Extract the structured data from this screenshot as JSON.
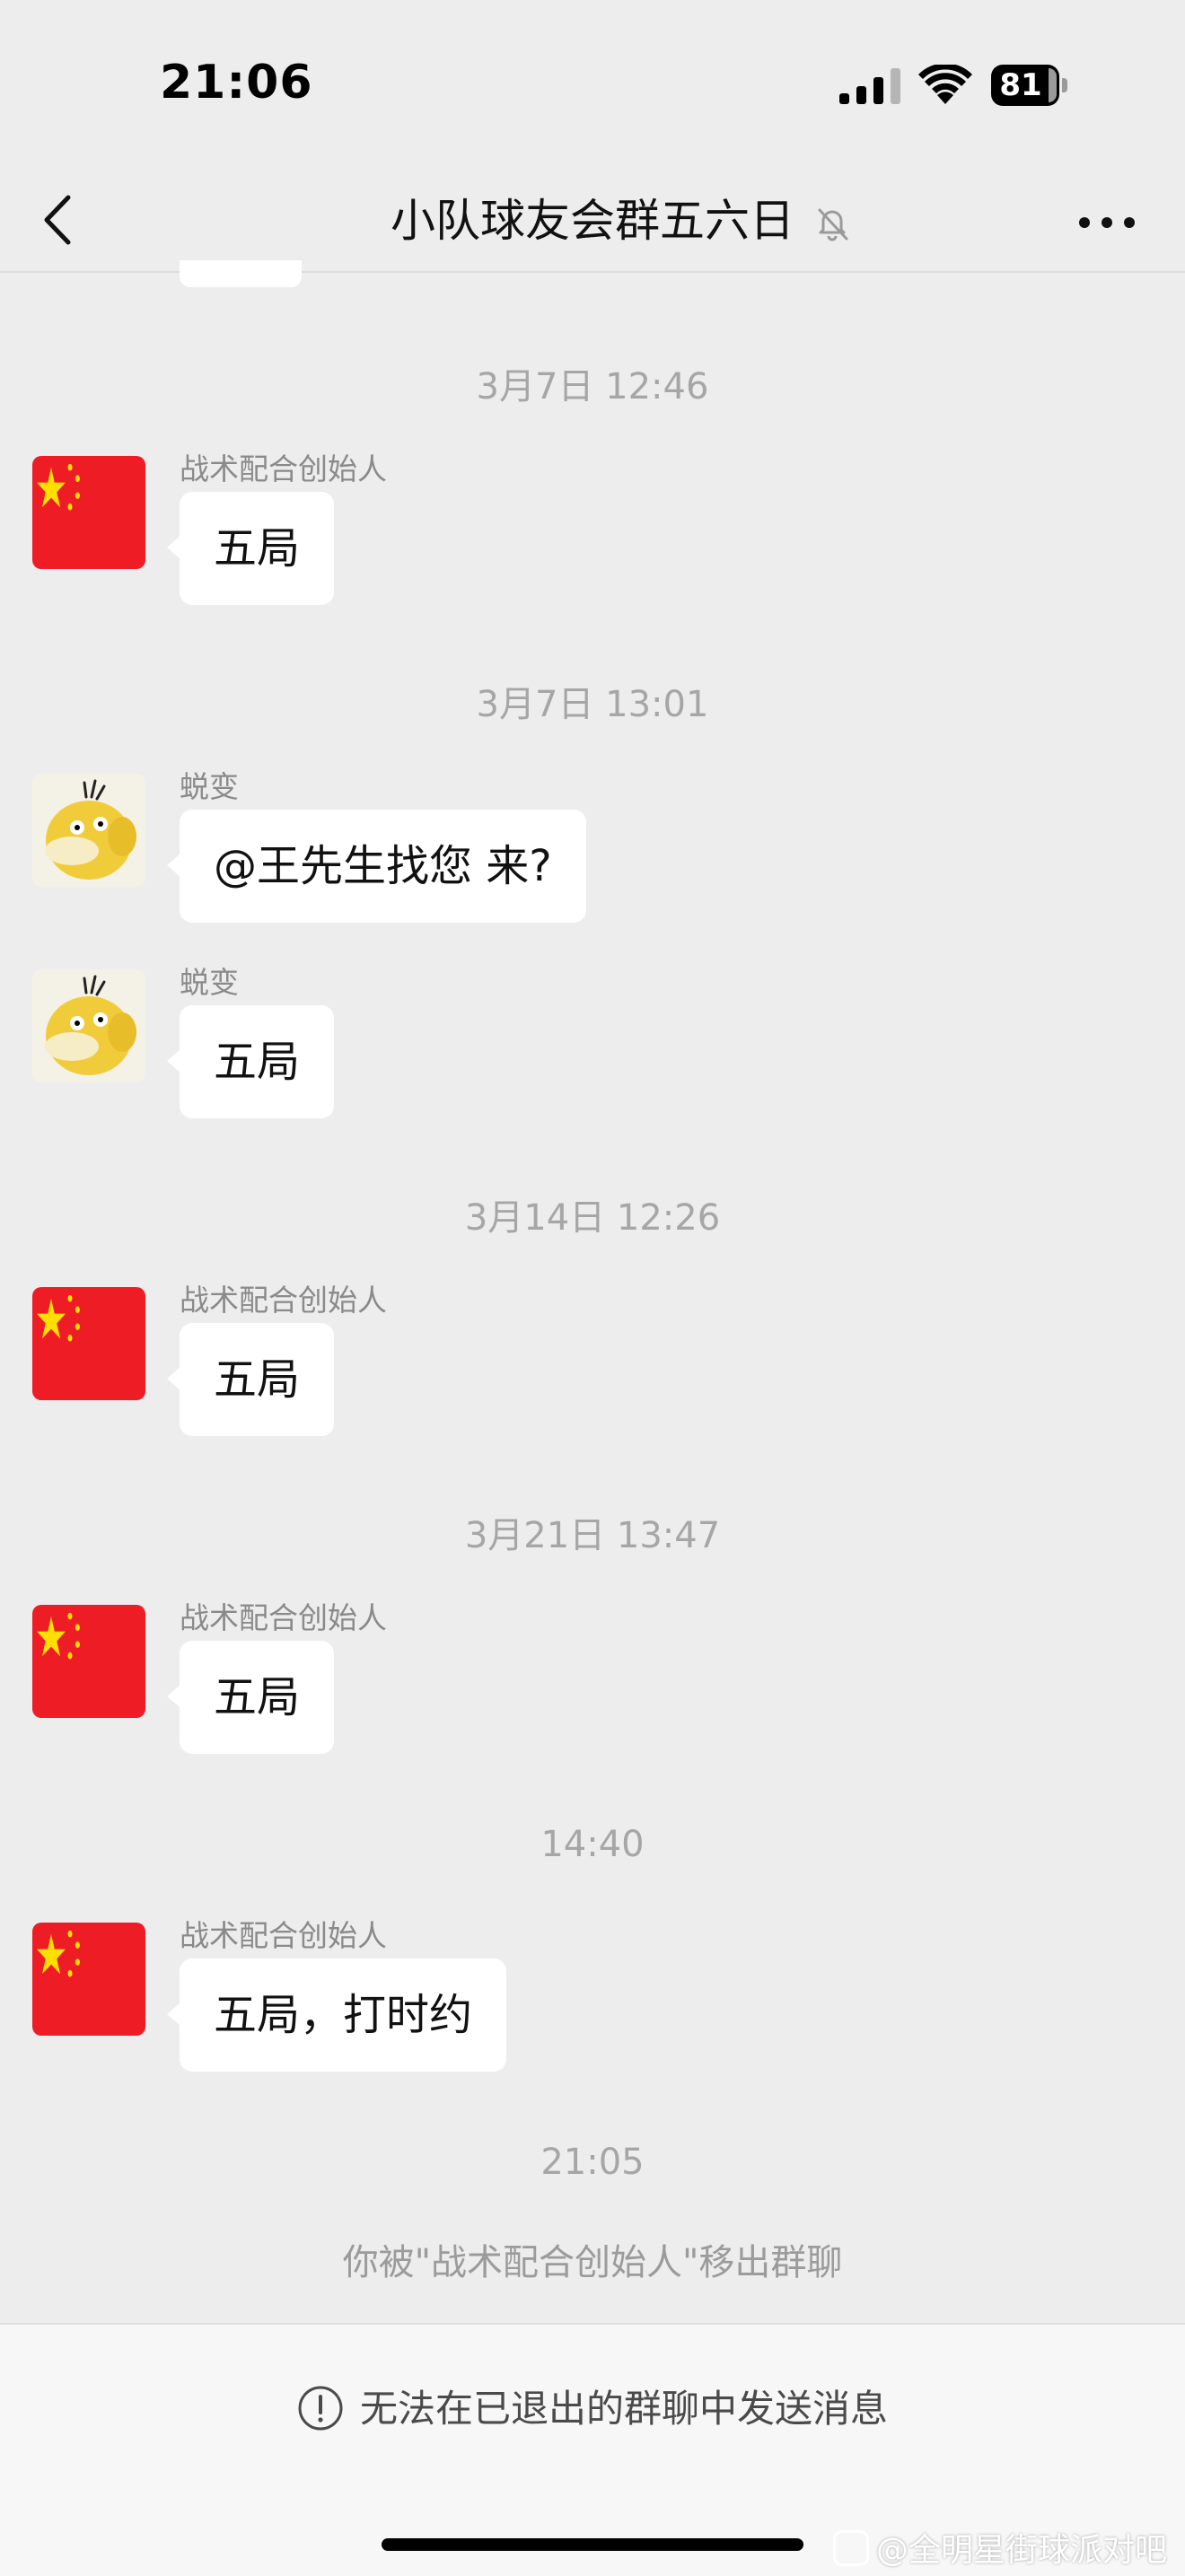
{
  "status_bar": {
    "time": "21:06",
    "battery_level": "81"
  },
  "header": {
    "title": "小队球友会群五六日",
    "back_icon": "chevron-left-icon",
    "mute_icon": "bell-slash-icon",
    "more_icon": "more-dots-icon"
  },
  "messages": [
    {
      "timestamp": "3月7日 12:46",
      "sender": "战术配合创始人",
      "avatar": "china-flag-avatar",
      "text": "五局"
    },
    {
      "timestamp": "3月7日 13:01",
      "sender": "蜕变",
      "avatar": "psyduck-avatar",
      "text": "@王先生找您 来?"
    },
    {
      "sender": "蜕变",
      "avatar": "psyduck-avatar",
      "text": "五局"
    },
    {
      "timestamp": "3月14日 12:26",
      "sender": "战术配合创始人",
      "avatar": "china-flag-avatar",
      "text": "五局"
    },
    {
      "timestamp": "3月21日 13:47",
      "sender": "战术配合创始人",
      "avatar": "china-flag-avatar",
      "text": "五局"
    },
    {
      "timestamp": "14:40",
      "sender": "战术配合创始人",
      "avatar": "china-flag-avatar",
      "text": "五局，打时约"
    }
  ],
  "system_event": {
    "timestamp": "21:05",
    "text": "你被\"战术配合创始人\"移出群聊"
  },
  "footer": {
    "notice": "无法在已退出的群聊中发送消息",
    "notice_icon": "exclamation-circle-icon",
    "watermark": "@全明星街球派对吧"
  },
  "colors": {
    "background": "#ededed",
    "bubble": "#ffffff",
    "flag_red": "#ee1c25",
    "flag_star": "#ffde00"
  }
}
